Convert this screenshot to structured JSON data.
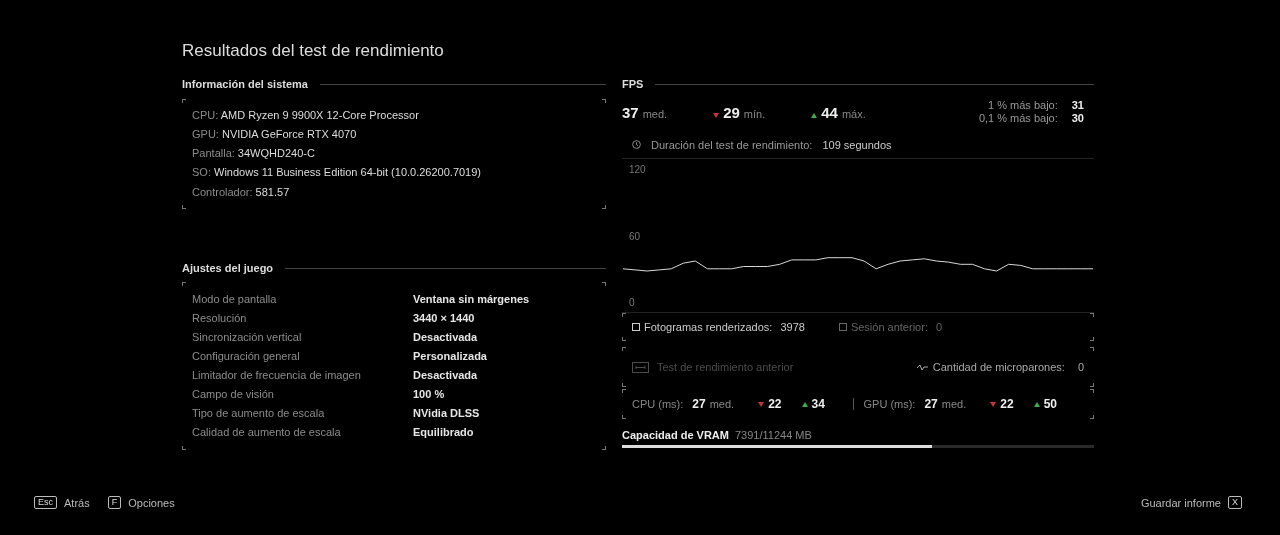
{
  "title": "Resultados del test de rendimiento",
  "system_info": {
    "heading": "Información del sistema",
    "rows": [
      {
        "label": "CPU:",
        "value": "AMD Ryzen 9 9900X 12-Core Processor"
      },
      {
        "label": "GPU:",
        "value": "NVIDIA GeForce RTX 4070"
      },
      {
        "label": "Pantalla:",
        "value": "34WQHD240-C"
      },
      {
        "label": "SO:",
        "value": "Windows 11 Business Edition 64-bit (10.0.26200.7019)"
      },
      {
        "label": "Controlador:",
        "value": "581.57"
      }
    ]
  },
  "game_settings": {
    "heading": "Ajustes del juego",
    "rows": [
      {
        "label": "Modo de pantalla",
        "value": "Ventana sin márgenes"
      },
      {
        "label": "Resolución",
        "value": "3440 × 1440"
      },
      {
        "label": "Sincronización vertical",
        "value": "Desactivada"
      },
      {
        "label": "Configuración general",
        "value": "Personalizada"
      },
      {
        "label": "Limitador de frecuencia de imagen",
        "value": "Desactivada"
      },
      {
        "label": "Campo de visión",
        "value": "100 %"
      },
      {
        "label": "Tipo de aumento de escala",
        "value": "NVidia DLSS"
      },
      {
        "label": "Calidad de aumento de escala",
        "value": "Equilibrado"
      }
    ]
  },
  "fps": {
    "heading": "FPS",
    "stats": [
      {
        "kind": "avg",
        "value": "37",
        "unit": "med."
      },
      {
        "kind": "min",
        "value": "29",
        "unit": "mín."
      },
      {
        "kind": "max",
        "value": "44",
        "unit": "máx."
      }
    ],
    "lows": [
      {
        "label": "1 % más bajo:",
        "value": "31"
      },
      {
        "label": "0,1 % más bajo:",
        "value": "30"
      }
    ],
    "duration": {
      "label": "Duración del test de rendimiento:",
      "value": "109 segundos"
    },
    "chart_data": {
      "type": "line",
      "ylim": [
        0,
        120
      ],
      "yticks": [
        0,
        60,
        120
      ],
      "series": [
        {
          "color": "#d8d8d8",
          "values": [
            30,
            29,
            28,
            29,
            30,
            35,
            37,
            30,
            30,
            30,
            32,
            32,
            32,
            34,
            38,
            38,
            38,
            40,
            40,
            40,
            37,
            30,
            34,
            37,
            38,
            39,
            37,
            36,
            34,
            34,
            30,
            28,
            34,
            33,
            30,
            30,
            30,
            30,
            30,
            30
          ]
        }
      ]
    },
    "frames": [
      {
        "label": "Fotogramas renderizados:",
        "value": "3978",
        "disabled": false
      },
      {
        "label": "Sesión anterior:",
        "value": "0",
        "disabled": true
      }
    ],
    "previous_test": {
      "label": "Test de rendimiento anterior",
      "disabled": true
    },
    "microstutters": {
      "label": "Cantidad de microparones:",
      "value": "0"
    },
    "frametimes": [
      {
        "label": "CPU (ms):",
        "avg": "27",
        "avg_unit": "med.",
        "min": "22",
        "max": "34"
      },
      {
        "label": "GPU (ms):",
        "avg": "27",
        "avg_unit": "med.",
        "min": "22",
        "max": "50"
      }
    ]
  },
  "vram": {
    "label": "Capacidad de VRAM",
    "value": "7391/11244 MB",
    "level": 0.657
  },
  "footer": {
    "left": [
      {
        "key": "Esc",
        "label": "Atrás"
      },
      {
        "key": "F",
        "label": "Opciones"
      }
    ],
    "right": [
      {
        "label": "Guardar informe",
        "key": "X"
      }
    ]
  }
}
